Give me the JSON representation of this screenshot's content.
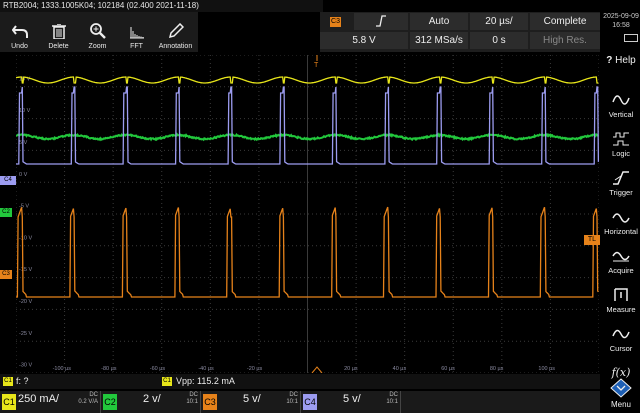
{
  "title_bar": "RTB2004; 1333.1005K04; 102184 (02.400 2021-11-18)",
  "toolbar": {
    "undo": "Undo",
    "delete": "Delete",
    "zoom": "Zoom",
    "fft": "FFT",
    "annotation": "Annotation"
  },
  "acquisition": {
    "trigger_source": "C3",
    "trigger_mode": "Auto",
    "time_scale": "20 µs/",
    "status": "Complete",
    "trigger_level": "5.8 V",
    "sample_rate": "312 MSa/s",
    "horizontal_position": "0 s",
    "mode": "High Res."
  },
  "clock": {
    "date": "2025-09-09",
    "time": "16:58"
  },
  "sidebar": {
    "help": "Help",
    "items": [
      "Vertical",
      "Logic",
      "Trigger",
      "Horizontal",
      "Acquire",
      "Measure",
      "Cursor",
      "Menu"
    ]
  },
  "grid": {
    "y_labels": [
      "15 V",
      "10 V",
      "5 V",
      "0 V",
      "-5 V",
      "-10 V",
      "-15 V",
      "-20 V",
      "-25 V",
      "-30 V"
    ],
    "x_labels": [
      "-100 µs",
      "-80 µs",
      "-60 µs",
      "-40 µs",
      "-20 µs",
      "20 µs",
      "40 µs",
      "60 µs",
      "80 µs",
      "100 µs"
    ]
  },
  "markers": {
    "ch4": "C4",
    "ch2": "C2",
    "ch3": "C3",
    "trigger_level": "TL",
    "trigger_pos": "T"
  },
  "measurements": {
    "m1_source": "C1",
    "m1": "f: ?",
    "m2_source": "C1",
    "m2": "Vpp: 115.2 mA"
  },
  "channels": [
    {
      "tag": "C1",
      "value": "250 mA/",
      "coupling": "DC",
      "extra": "0.2 V/A",
      "color": "#e8e61a"
    },
    {
      "tag": "C2",
      "value": "2 v/",
      "coupling": "DC",
      "extra": "10:1",
      "color": "#22c83c"
    },
    {
      "tag": "C3",
      "value": "5 v/",
      "coupling": "DC",
      "extra": "10:1",
      "color": "#e6821a"
    },
    {
      "tag": "C4",
      "value": "5 v/",
      "coupling": "DC",
      "extra": "10:1",
      "color": "#9c9cf0"
    }
  ],
  "colors": {
    "ch1": "#e8e61a",
    "ch2": "#22c83c",
    "ch3": "#e6821a",
    "ch4": "#9c9cf0",
    "grid": "#3a3a3a"
  }
}
